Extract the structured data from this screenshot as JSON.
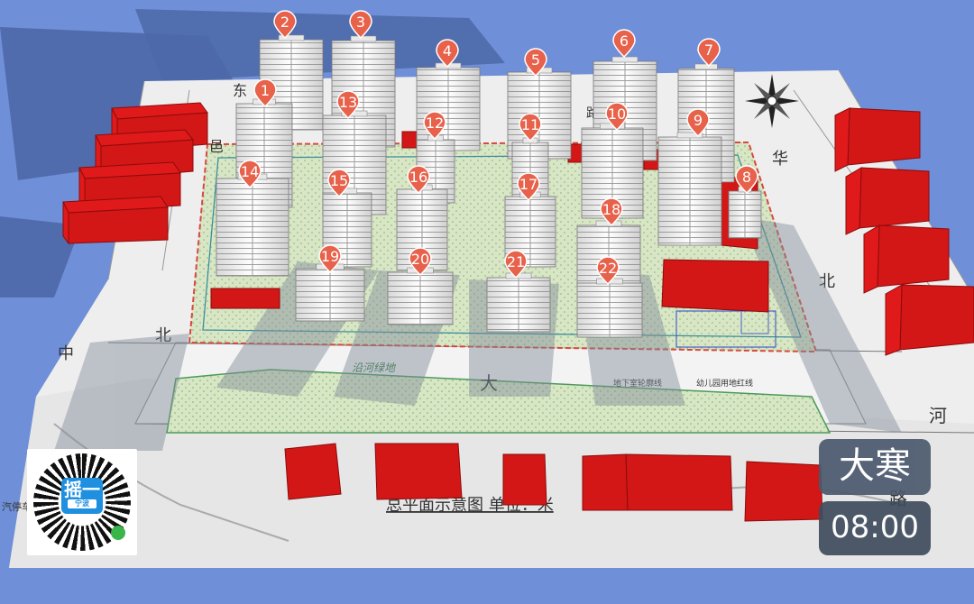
{
  "map": {
    "buildings": [
      "1",
      "2",
      "3",
      "4",
      "5",
      "6",
      "7",
      "8",
      "9",
      "10",
      "11",
      "12",
      "13",
      "14",
      "15",
      "16",
      "17",
      "18",
      "19",
      "20",
      "21",
      "22"
    ],
    "road_labels": {
      "dong": "东",
      "yi": "邑",
      "bei_left": "北",
      "zhong": "中",
      "lu_top": "路",
      "hua": "华",
      "bei_right": "北",
      "he": "河",
      "da": "大",
      "lu_bottom": "路"
    },
    "plan_labels": {
      "riverside_green": "沿河绿地",
      "underground_boundary": "地下室轮廓线",
      "kindergarten_redline": "幼儿园用地红线",
      "plan_title": "总平面示意图 单位：米",
      "parking": "汽停车"
    },
    "colors": {
      "background": "#6f8fd8",
      "red_block": "#e01a1a",
      "marker": "#e8614a",
      "green_plot": "#cfe3b7"
    }
  },
  "qr": {
    "logo_big": "摇一",
    "logo_small": "宁波"
  },
  "solar_term": "大寒",
  "time": "08:00"
}
